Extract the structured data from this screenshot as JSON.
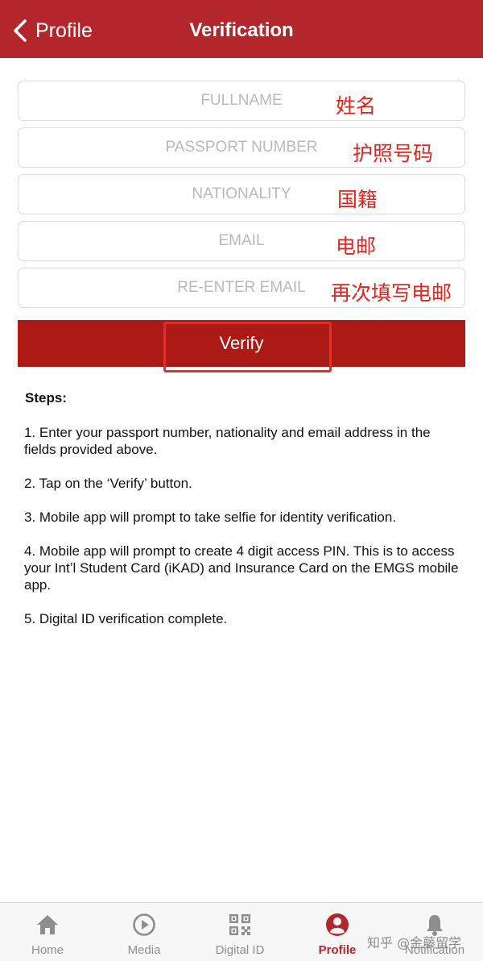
{
  "header": {
    "back_label": "Profile",
    "title": "Verification"
  },
  "form": {
    "fields": [
      {
        "placeholder": "FULLNAME",
        "value": "",
        "annotation": "姓名"
      },
      {
        "placeholder": "PASSPORT NUMBER",
        "value": "",
        "annotation": "护照号码"
      },
      {
        "placeholder": "NATIONALITY",
        "value": "",
        "annotation": "国籍"
      },
      {
        "placeholder": "EMAIL",
        "value": "",
        "annotation": "电邮"
      },
      {
        "placeholder": "RE-ENTER EMAIL",
        "value": "",
        "annotation": "再次填写电邮"
      }
    ],
    "verify_label": "Verify"
  },
  "steps": {
    "heading": "Steps:",
    "items": [
      "1. Enter your passport number, nationality and email address in the fields provided above.",
      "2. Tap on the ‘Verify’ button.",
      "3. Mobile app will prompt to take selfie for identity verification.",
      "4. Mobile app will prompt to create 4 digit access PIN. This is to access your Int’l Student Card (iKAD) and Insurance Card on the EMGS mobile app.",
      "5. Digital ID verification complete."
    ]
  },
  "tabbar": {
    "active": "Profile",
    "tabs": [
      {
        "label": "Home",
        "icon": "home-icon"
      },
      {
        "label": "Media",
        "icon": "play-circle-icon"
      },
      {
        "label": "Digital ID",
        "icon": "qr-code-icon"
      },
      {
        "label": "Profile",
        "icon": "user-circle-icon"
      },
      {
        "label": "Notification",
        "icon": "bell-icon"
      }
    ]
  },
  "watermark": "知乎 @金藤留学",
  "colors": {
    "brand": "#b3262b",
    "verify_button": "#ab1a14",
    "annotation": "#e0241e",
    "tab_inactive": "#8e8e8e"
  }
}
